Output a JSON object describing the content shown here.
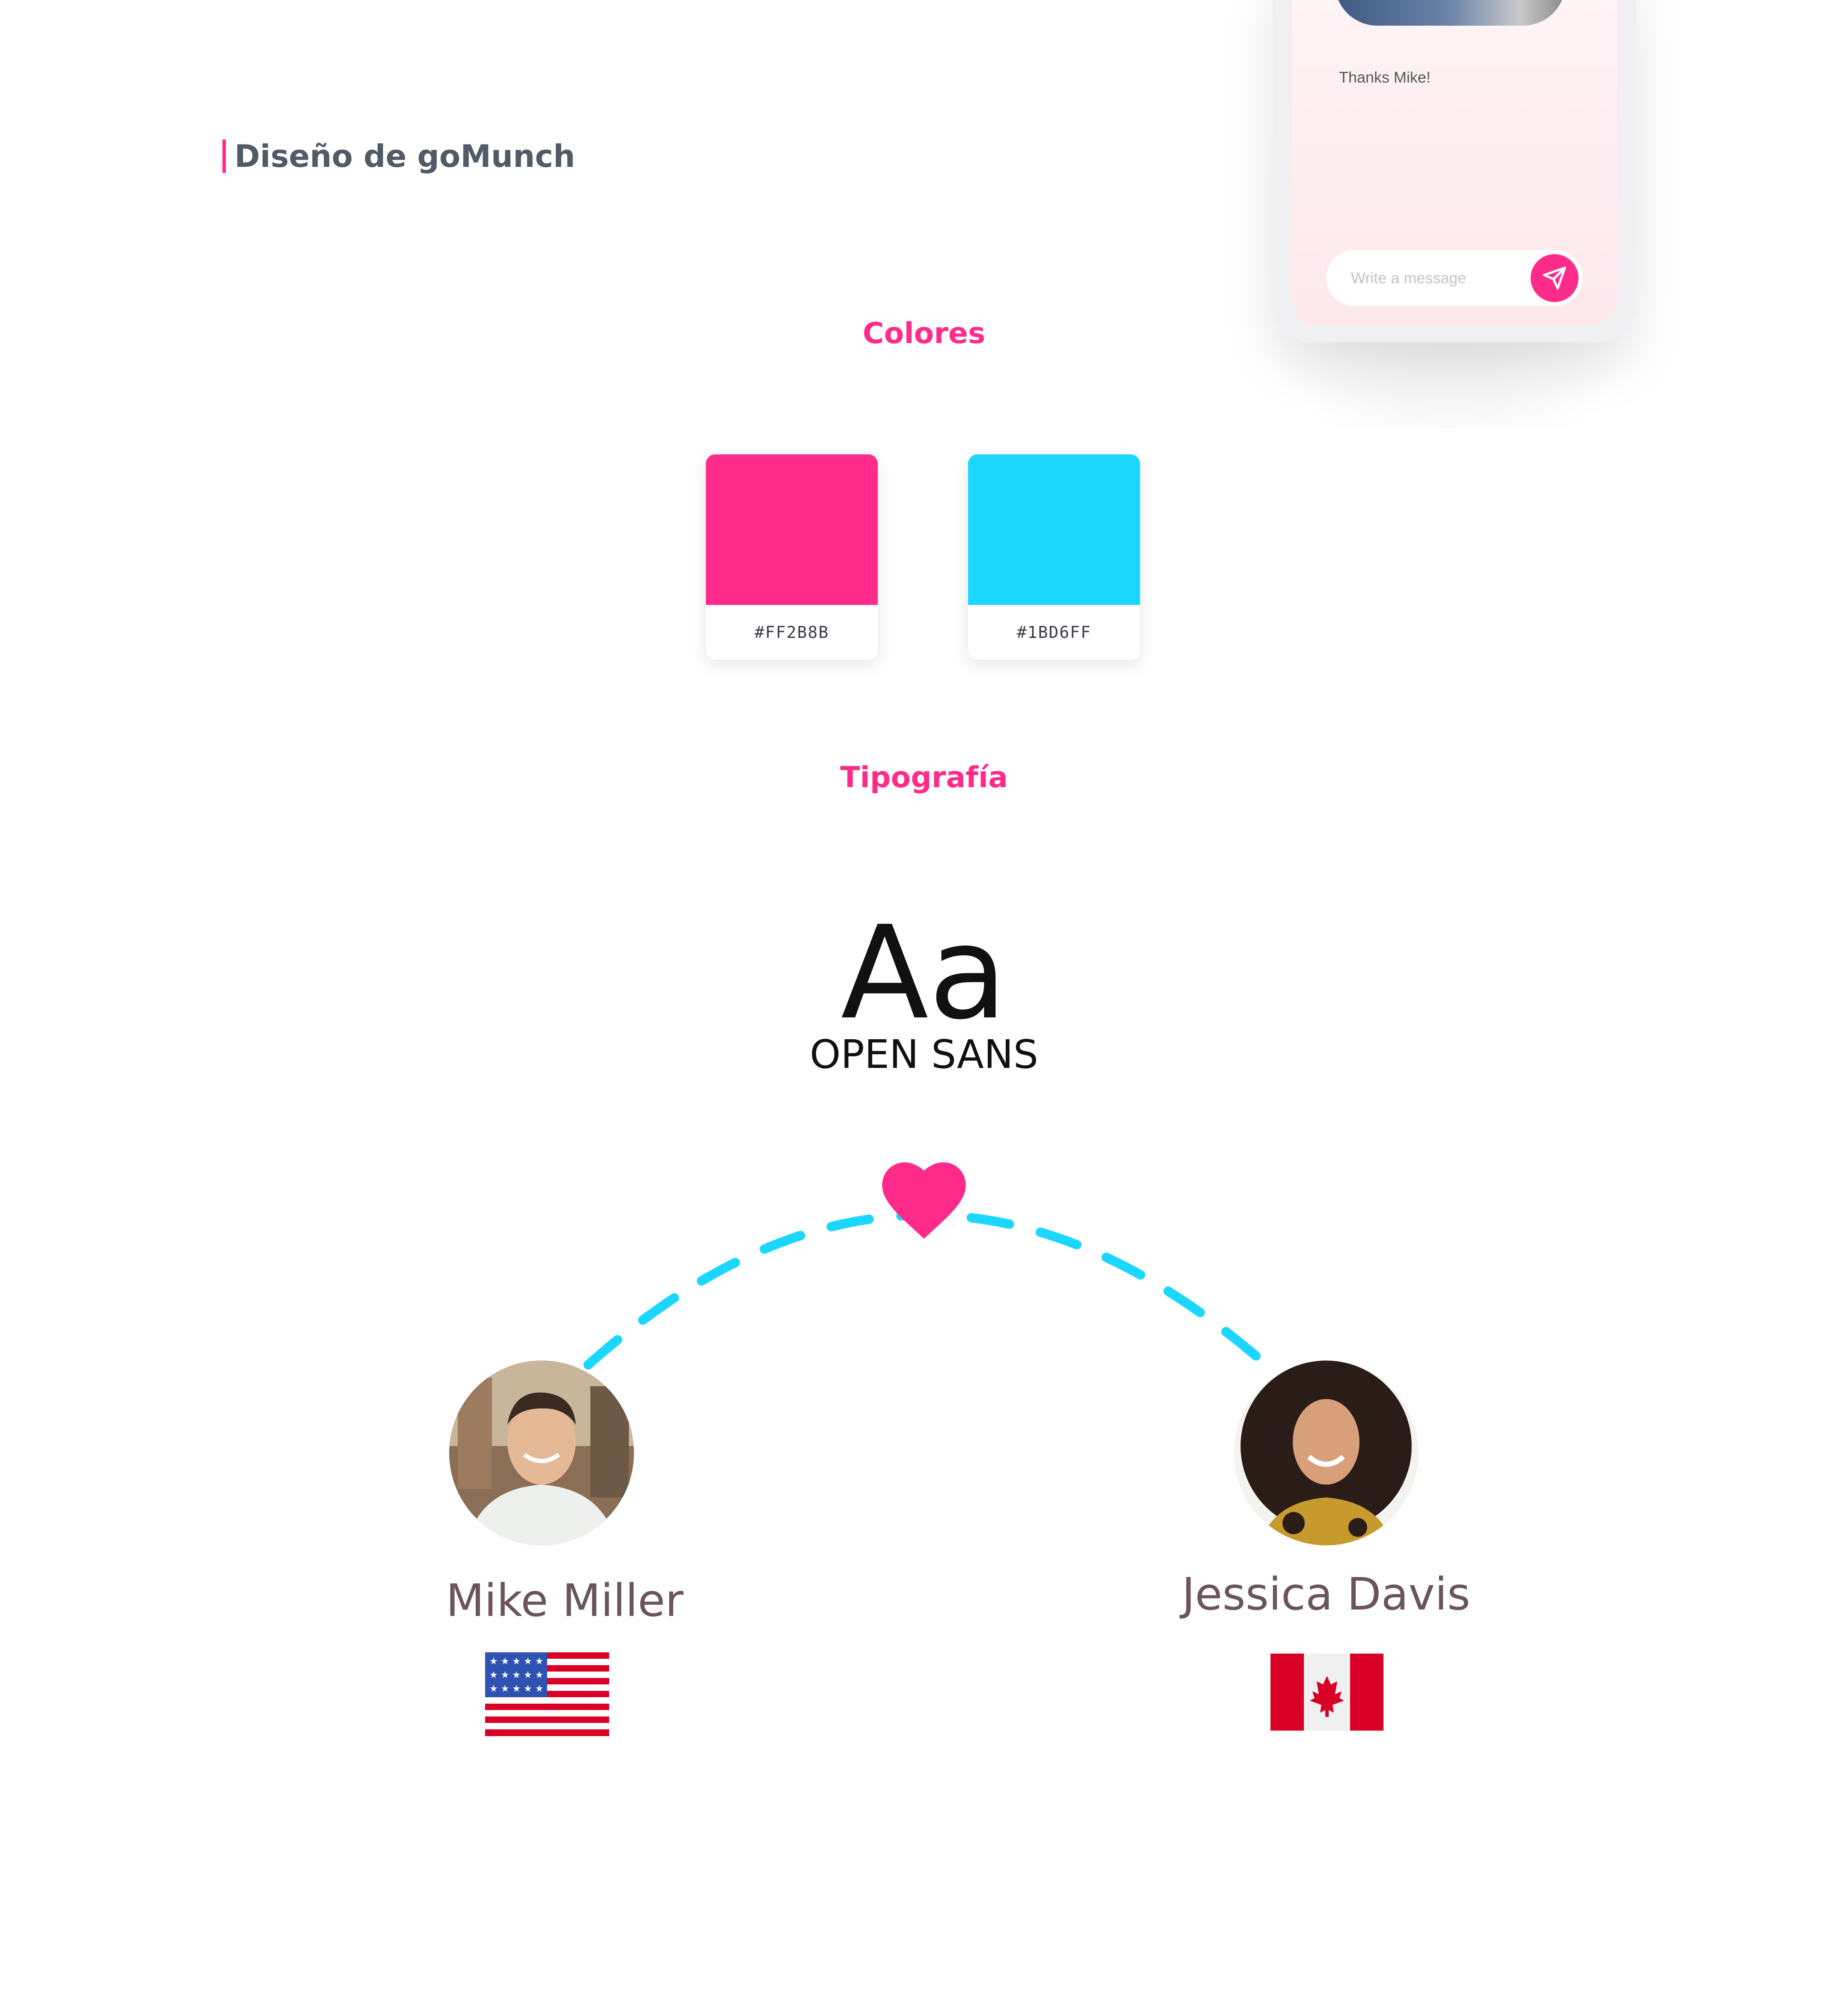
{
  "header": {
    "title": "Diseño de goMunch"
  },
  "phone": {
    "message": "Thanks Mike!",
    "input_placeholder": "Write a message"
  },
  "colors_section": {
    "title": "Colores",
    "swatches": [
      {
        "hex": "#FF2B8B",
        "label": "#FF2B8B"
      },
      {
        "hex": "#1BD6FF",
        "label": "#1BD6FF"
      }
    ]
  },
  "typography_section": {
    "title": "Tipografía",
    "sample": "Aa",
    "font_name": "OPEN SANS"
  },
  "match": {
    "left": {
      "name": "Mike Miller",
      "flag": "us-flag-icon"
    },
    "right": {
      "name": "Jessica Davis",
      "flag": "canada-flag-icon"
    }
  },
  "palette": {
    "accent_pink": "#FF2B8B",
    "accent_cyan": "#1BD6FF",
    "title_gray": "#4f5b66",
    "name_color": "#6b545c"
  }
}
